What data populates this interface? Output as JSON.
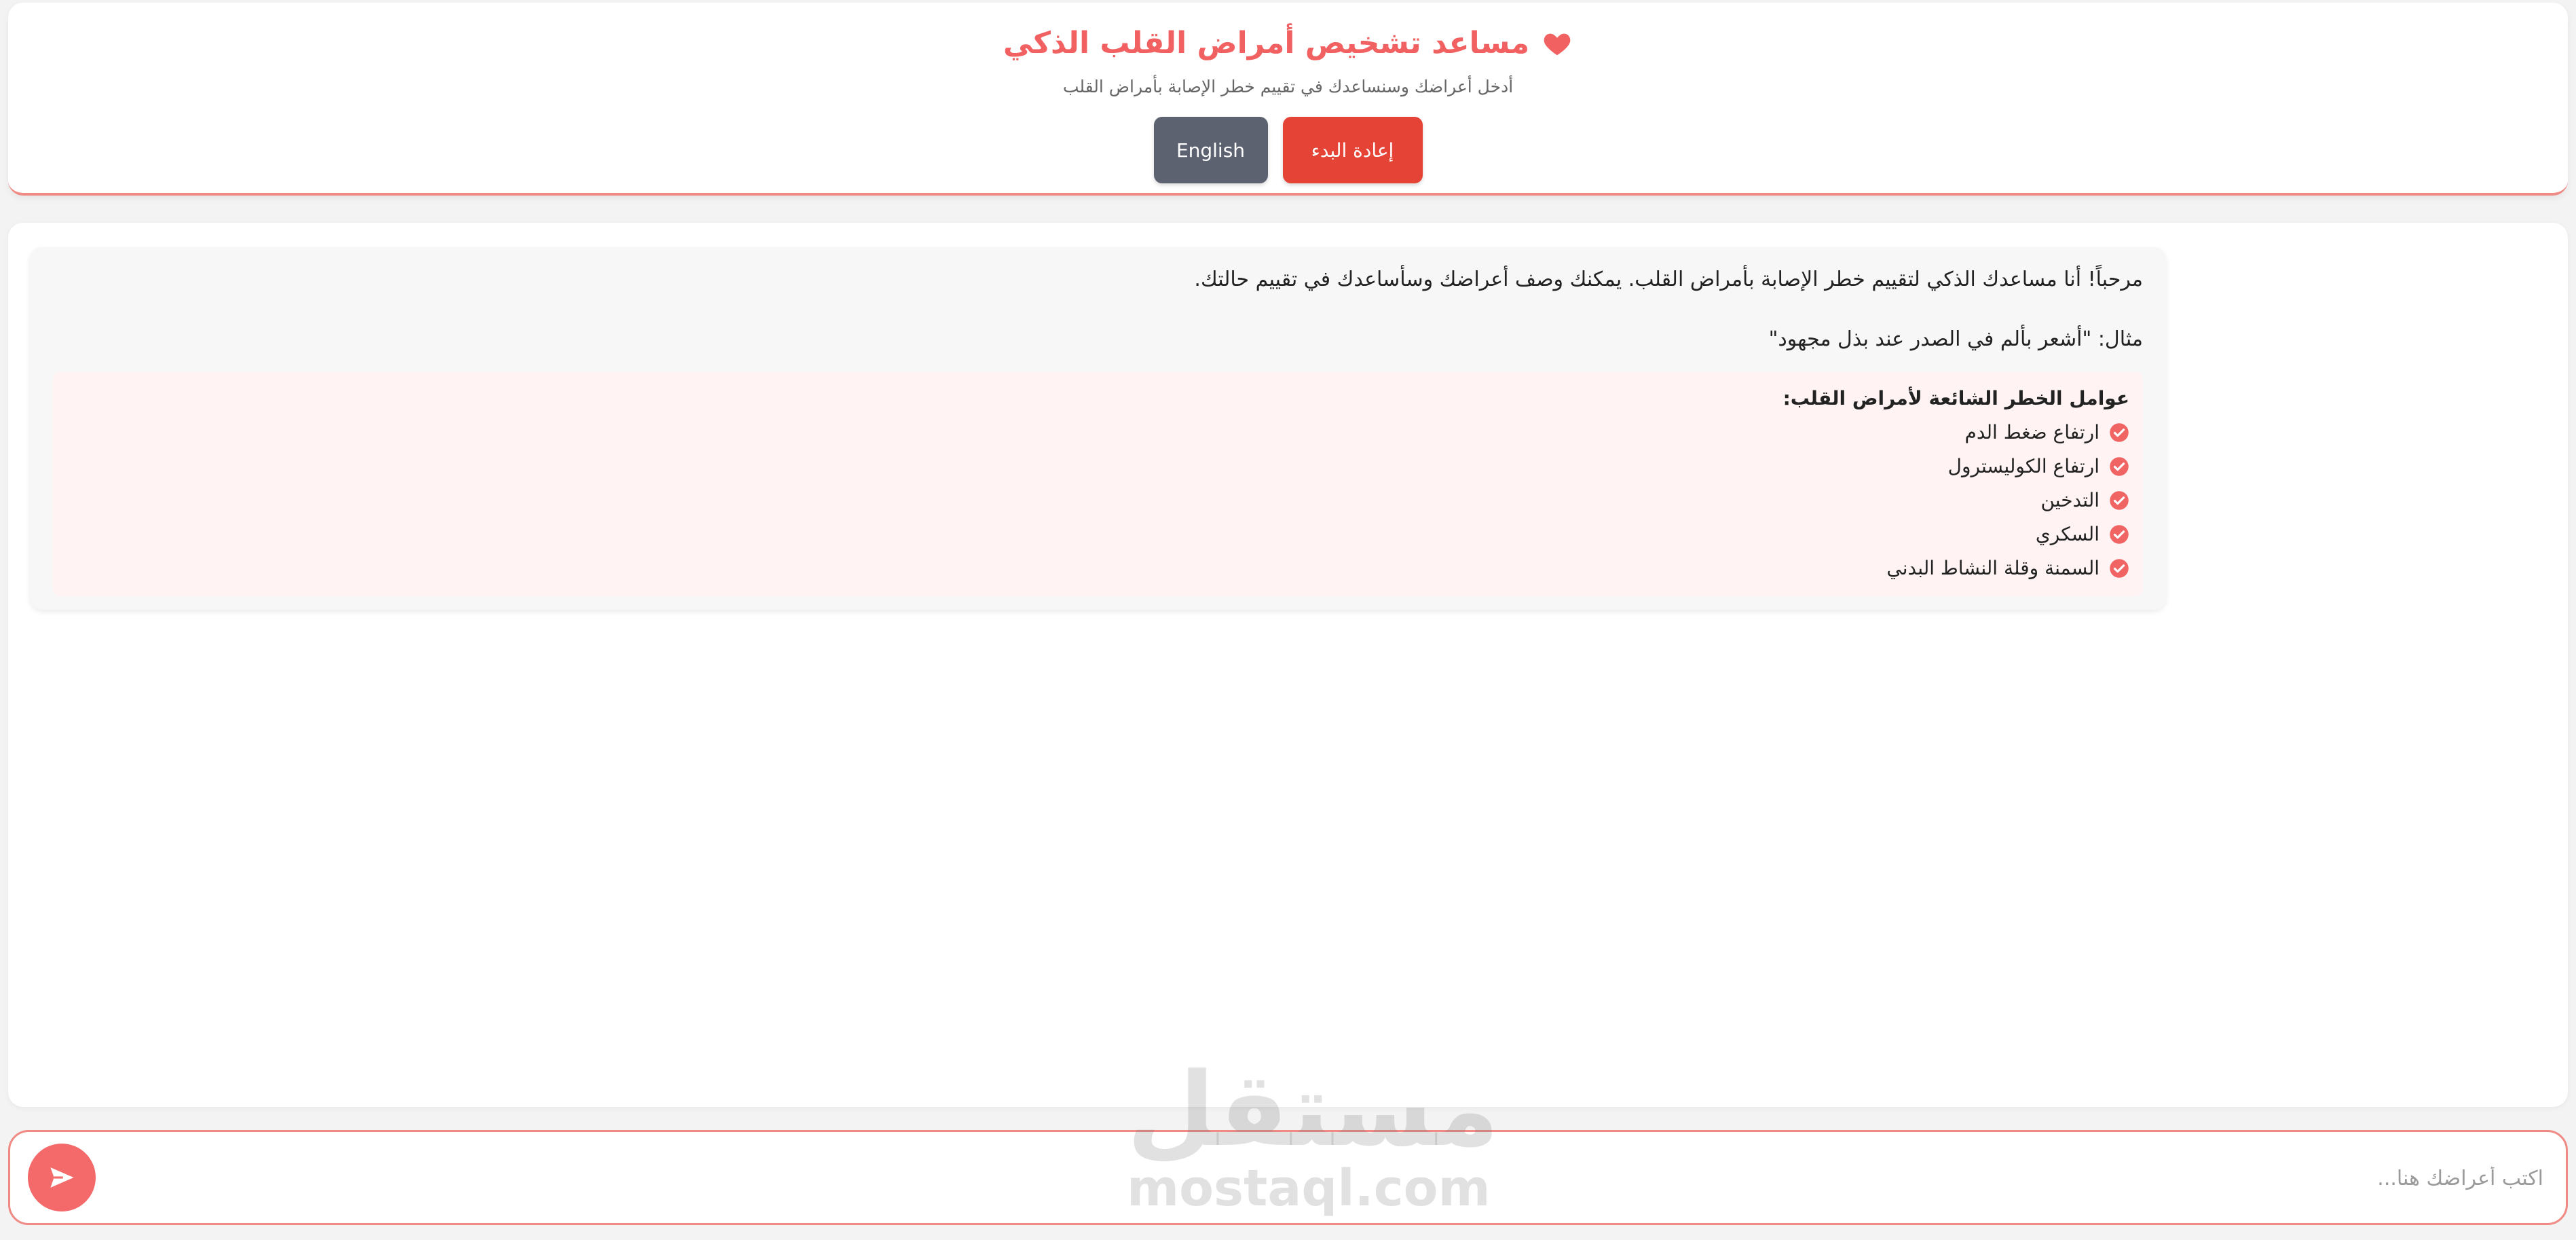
{
  "header": {
    "title": "مساعد تشخيص أمراض القلب الذكي",
    "subtitle": "أدخل أعراضك وسنساعدك في تقييم خطر الإصابة بأمراض القلب",
    "restart_label": "إعادة البدء",
    "language_label": "English"
  },
  "chat": {
    "welcome": "مرحباً! أنا مساعدك الذكي لتقييم خطر الإصابة بأمراض القلب. يمكنك وصف أعراضك وسأساعدك في تقييم حالتك.",
    "example": "مثال: \"أشعر بألم في الصدر عند بذل مجهود\"",
    "risk_title": "عوامل الخطر الشائعة لأمراض القلب:",
    "risk_factors": [
      "ارتفاع ضغط الدم",
      "ارتفاع الكوليسترول",
      "التدخين",
      "السكري",
      "السمنة وقلة النشاط البدني"
    ]
  },
  "input": {
    "placeholder": "اكتب أعراضك هنا...",
    "value": ""
  },
  "watermark": {
    "arabic": "مستقل",
    "latin": "mostaql.com"
  },
  "colors": {
    "accent": "#f26161",
    "restart_button": "#e54335",
    "language_button": "#5d6270",
    "risk_background": "#fff4f3"
  },
  "icons": {
    "title": "heart-icon",
    "risk_item": "check-circle-icon",
    "send": "send-icon"
  }
}
